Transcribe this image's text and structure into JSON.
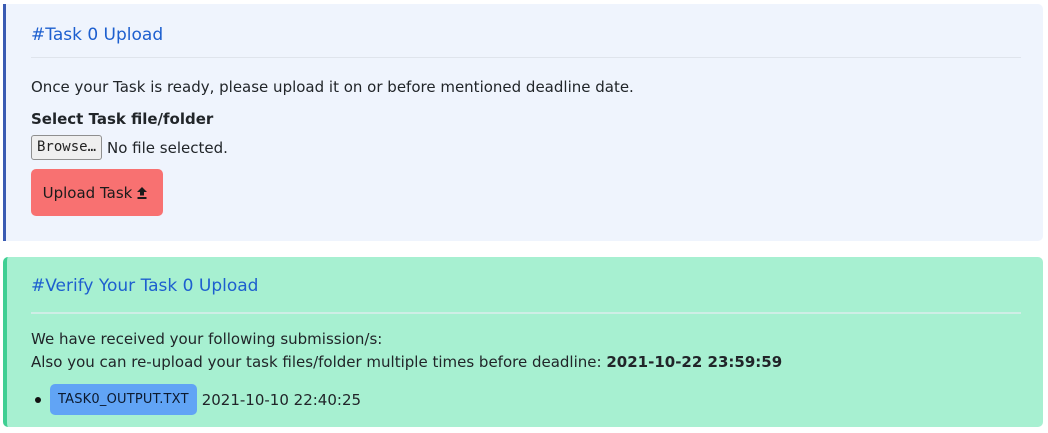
{
  "upload_card": {
    "title": "#Task 0 Upload",
    "intro": "Once your Task is ready, please upload it on or before mentioned deadline date.",
    "field_label": "Select Task file/folder",
    "browse_label": "Browse…",
    "file_status": "No file selected.",
    "upload_button": "Upload Task",
    "upload_icon": "upload-icon"
  },
  "verify_card": {
    "title": "#Verify Your Task 0 Upload",
    "received_text": "We have received your following submission/s:",
    "reupload_prefix": "Also you can re-upload your task files/folder multiple times before deadline:",
    "deadline": "2021-10-22 23:59:59",
    "submissions": [
      {
        "filename": "TASK0_OUTPUT.TXT",
        "timestamp": "2021-10-10 22:40:25"
      }
    ]
  },
  "colors": {
    "title_blue": "#1d5fcf",
    "upload_card_bg": "#eff4fd",
    "verify_card_bg": "#a7f0d1",
    "upload_button_bg": "#f87171",
    "file_badge_bg": "#61a4f5"
  }
}
